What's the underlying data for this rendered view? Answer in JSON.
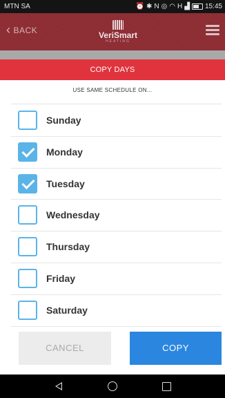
{
  "status_bar": {
    "carrier": "MTN SA",
    "icons": [
      "alarm-icon",
      "bluetooth-icon",
      "nfc-icon",
      "data-icon",
      "wifi-icon",
      "signal-icon",
      "battery-icon"
    ],
    "signal_label": "H",
    "time": "15:45"
  },
  "header": {
    "back_label": "BACK",
    "logo_text": "VeriSmart",
    "logo_sub": "HEATING",
    "colors": {
      "bar": "#8d2c33"
    }
  },
  "banner": {
    "title": "COPY DAYS",
    "color": "#e0333e"
  },
  "subtitle": "USE SAME SCHEDULE ON...",
  "days": [
    {
      "label": "Sunday",
      "checked": false
    },
    {
      "label": "Monday",
      "checked": true
    },
    {
      "label": "Tuesday",
      "checked": true
    },
    {
      "label": "Wednesday",
      "checked": false
    },
    {
      "label": "Thursday",
      "checked": false
    },
    {
      "label": "Friday",
      "checked": false
    },
    {
      "label": "Saturday",
      "checked": false
    }
  ],
  "actions": {
    "cancel_label": "CANCEL",
    "copy_label": "COPY",
    "copy_color": "#2b86e0"
  },
  "nav": {
    "icons": [
      "back-triangle-icon",
      "home-circle-icon",
      "recents-square-icon"
    ]
  }
}
